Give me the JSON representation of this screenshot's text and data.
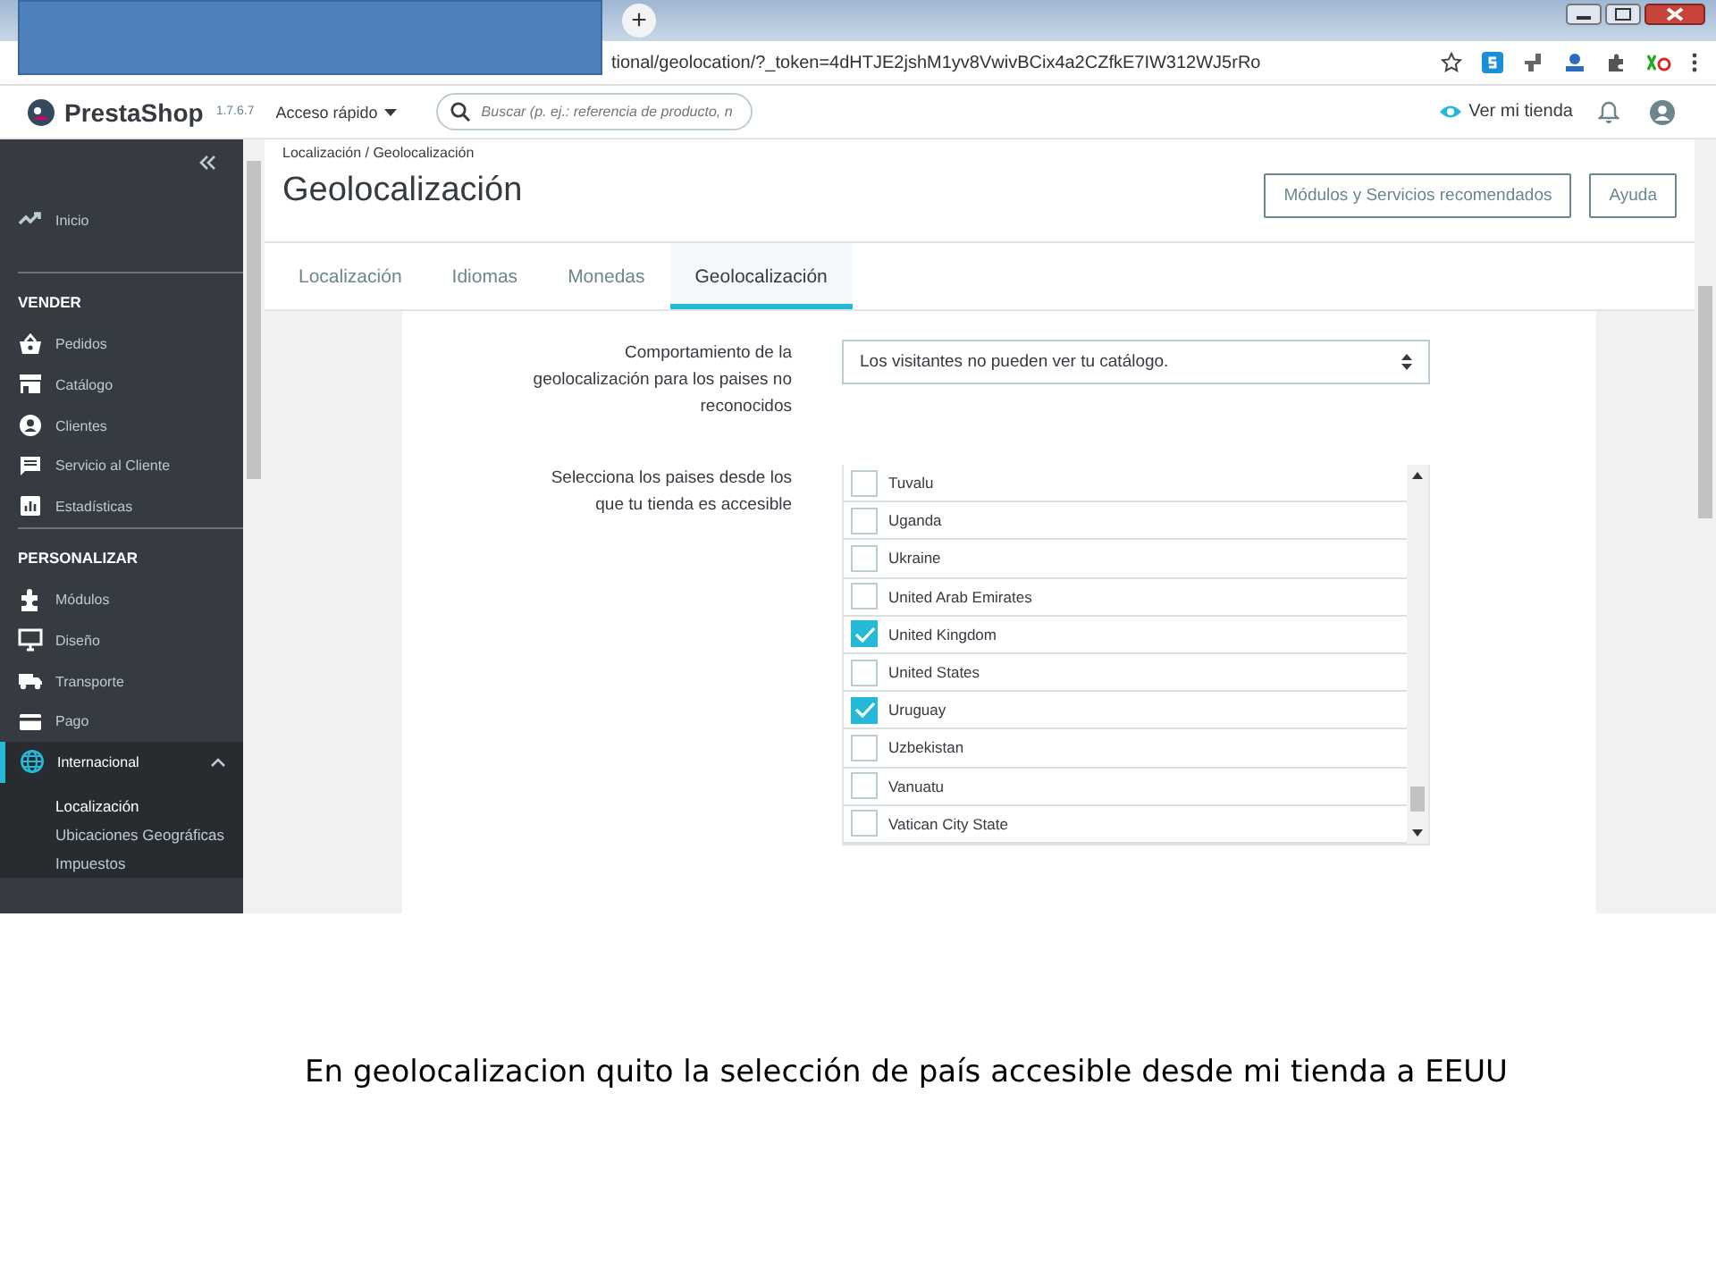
{
  "browser": {
    "new_tab": "+",
    "url": "tional/geolocation/?_token=4dHTJE2jshM1yv8VwivBCix4a2CZfkE7IW312WJ5rRo"
  },
  "header": {
    "logo": "PrestaShop",
    "version": "1.7.6.7",
    "quick_access": "Acceso rápido",
    "search_placeholder": "Buscar (p. ej.: referencia de producto, n",
    "view_store": "Ver mi tienda"
  },
  "sidebar": {
    "items": [
      {
        "kind": "link",
        "label": "Inicio",
        "selected": false
      },
      {
        "kind": "section",
        "label": "VENDER"
      },
      {
        "kind": "link",
        "label": "Pedidos",
        "selected": false
      },
      {
        "kind": "link",
        "label": "Catálogo",
        "selected": false
      },
      {
        "kind": "link",
        "label": "Clientes",
        "selected": false
      },
      {
        "kind": "link",
        "label": "Servicio al Cliente",
        "selected": false
      },
      {
        "kind": "link",
        "label": "Estadísticas",
        "selected": false
      },
      {
        "kind": "section",
        "label": "PERSONALIZAR"
      },
      {
        "kind": "link",
        "label": "Módulos",
        "selected": false
      },
      {
        "kind": "link",
        "label": "Diseño",
        "selected": false
      },
      {
        "kind": "link",
        "label": "Transporte",
        "selected": false
      },
      {
        "kind": "link",
        "label": "Pago",
        "selected": false
      },
      {
        "kind": "link",
        "label": "Internacional",
        "selected": true,
        "expanded": true,
        "children": [
          {
            "label": "Localización",
            "selected": true
          },
          {
            "label": "Ubicaciones Geográficas",
            "selected": false
          },
          {
            "label": "Impuestos",
            "selected": false
          }
        ]
      }
    ]
  },
  "breadcrumb": "Localización /  Geolocalización",
  "page_title": "Geolocalización",
  "toolbar_buttons": [
    "Módulos y Servicios recomendados",
    "Ayuda"
  ],
  "tabs": [
    {
      "label": "Localización",
      "selected": false
    },
    {
      "label": "Idiomas",
      "selected": false
    },
    {
      "label": "Monedas",
      "selected": false
    },
    {
      "label": "Geolocalización",
      "selected": true
    }
  ],
  "form": {
    "behavior_label": "Comportamiento de la geolocalización para los paises no reconocidos",
    "behavior_value": "Los visitantes no pueden ver tu catálogo.",
    "countries_label": "Selecciona los paises desde los que tu tienda es accesible",
    "countries": [
      {
        "label": "Tuvalu",
        "checked": false
      },
      {
        "label": "Uganda",
        "checked": false
      },
      {
        "label": "Ukraine",
        "checked": false
      },
      {
        "label": "United Arab Emirates",
        "checked": false
      },
      {
        "label": "United Kingdom",
        "checked": true
      },
      {
        "label": "United States",
        "checked": false
      },
      {
        "label": "Uruguay",
        "checked": true
      },
      {
        "label": "Uzbekistan",
        "checked": false
      },
      {
        "label": "Vanuatu",
        "checked": false
      },
      {
        "label": "Vatican City State",
        "checked": false
      }
    ]
  },
  "caption": "En geolocalizacion quito la selección de país accesible desde mi tienda a EEUU"
}
